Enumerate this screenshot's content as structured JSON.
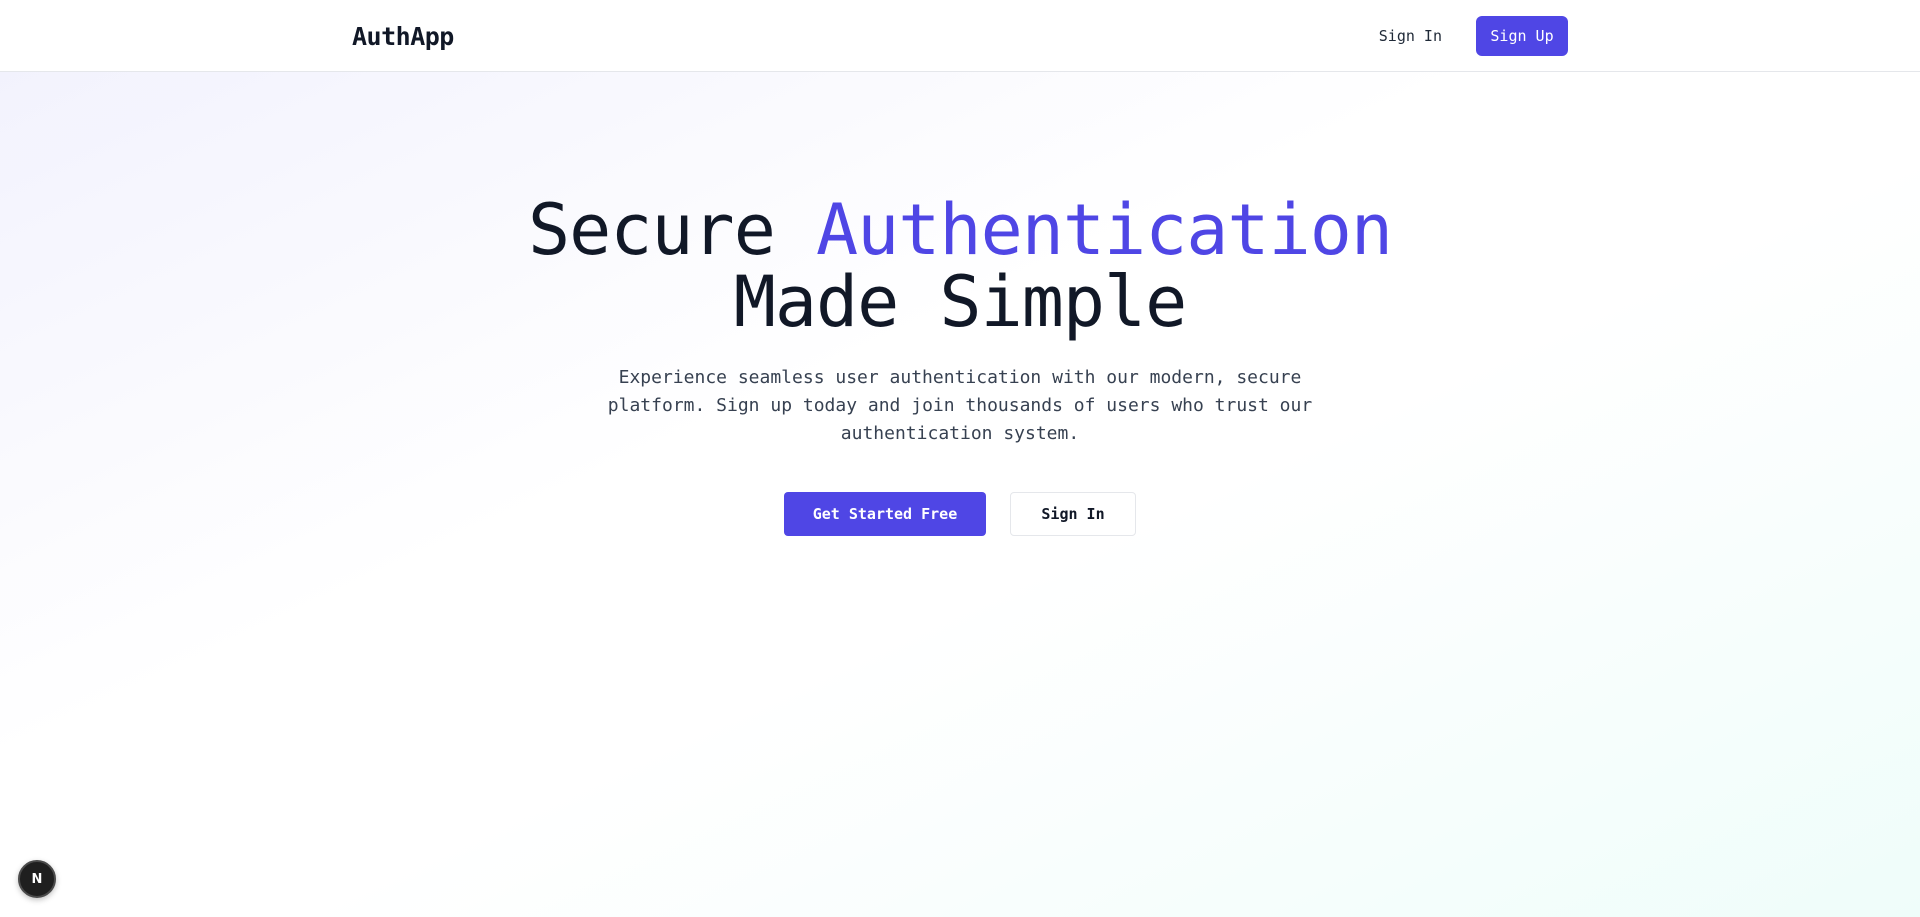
{
  "navbar": {
    "logo": "AuthApp",
    "signin_label": "Sign In",
    "signup_label": "Sign Up"
  },
  "hero": {
    "title_part1": "Secure ",
    "title_accent": "Authentication",
    "title_part2": "Made Simple",
    "subtitle": "Experience seamless user authentication with our modern, secure platform. Sign up today and join thousands of users who trust our authentication system.",
    "cta_primary": "Get Started Free",
    "cta_secondary": "Sign In"
  },
  "dev_badge": {
    "letter": "N",
    "icon": "nextjs-icon"
  },
  "colors": {
    "accent": "#4f46e5",
    "text": "#111827"
  }
}
